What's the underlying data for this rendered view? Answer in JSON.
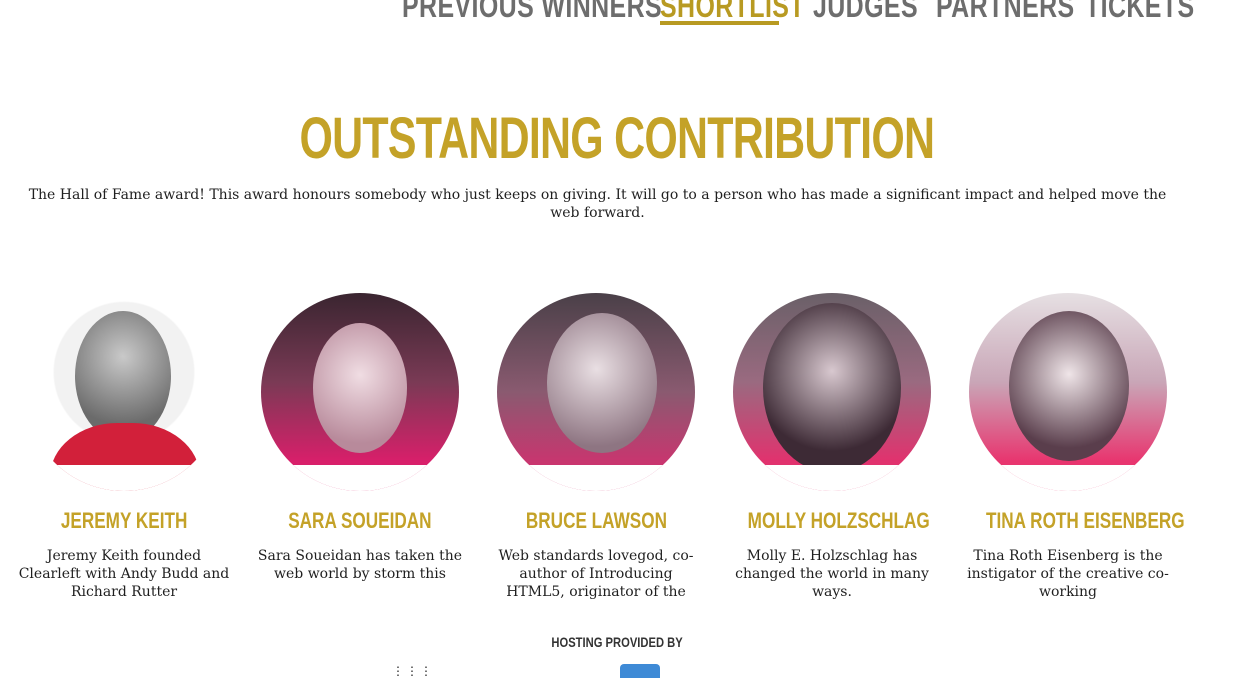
{
  "nav": {
    "items": [
      {
        "label": "Previous Winners",
        "active": false
      },
      {
        "label": "Shortlist",
        "active": true
      },
      {
        "label": "Judges",
        "active": false
      },
      {
        "label": "Partners",
        "active": false
      },
      {
        "label": "Tickets",
        "active": false
      }
    ]
  },
  "section": {
    "title": "OUTSTANDING CONTRIBUTION",
    "intro": "The Hall of Fame award! This award honours somebody who just keeps on giving. It will go to a person who has made a significant impact and helped move the web forward."
  },
  "nominees": [
    {
      "name": "JEREMY KEITH",
      "bio": "Jeremy Keith founded Clearleft with Andy Budd and Richard Rutter"
    },
    {
      "name": "SARA SOUEIDAN",
      "bio": "Sara Soueidan has taken the web world by storm this"
    },
    {
      "name": "BRUCE LAWSON",
      "bio": "Web standards lovegod, co-author of Introducing HTML5, originator of the"
    },
    {
      "name": "MOLLY HOLZSCHLAG",
      "bio": "Molly E. Holzschlag has changed the world in many ways."
    },
    {
      "name": "TINA ROTH EISENBERG",
      "bio": "Tina Roth Eisenberg is the instigator of the creative co-working"
    }
  ],
  "footer": {
    "hosting_label": "HOSTING PROVIDED BY"
  },
  "colors": {
    "accent": "#c4a228",
    "nav_text": "#6d6d6d",
    "duotone_pink": "#e0286b"
  }
}
